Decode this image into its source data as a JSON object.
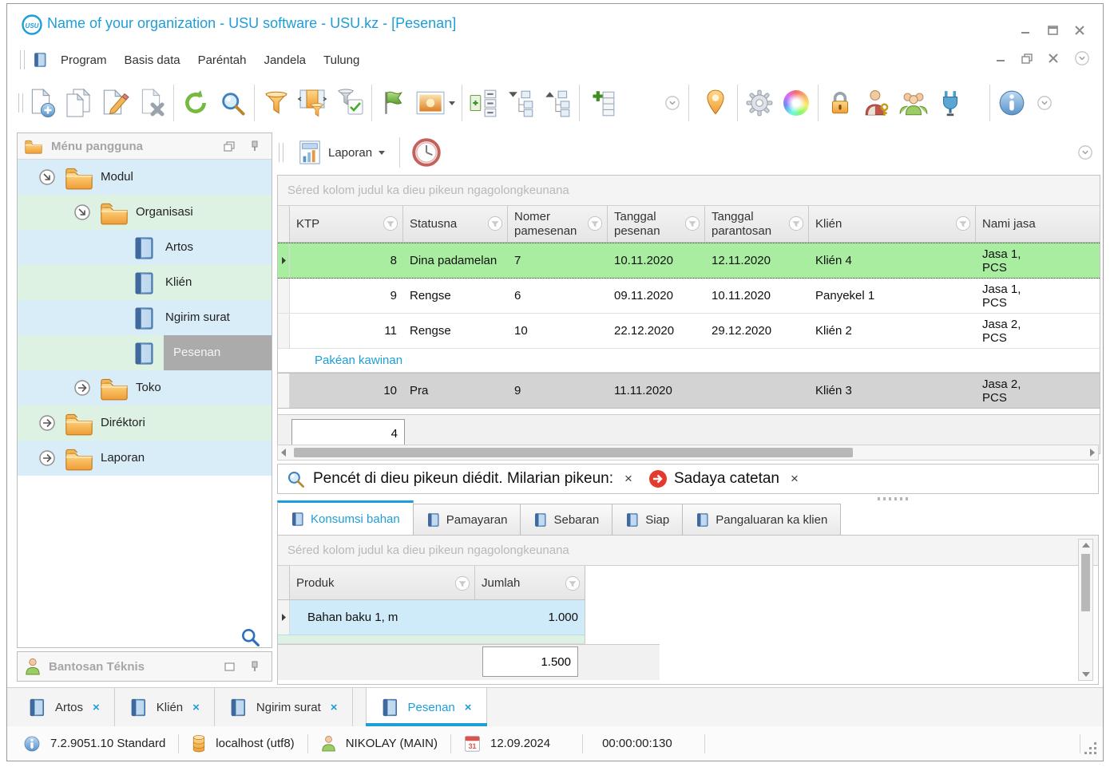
{
  "window": {
    "title": "Name of your organization - USU software - USU.kz - [Pesenan]",
    "logo_text": "USU"
  },
  "menu_bar": {
    "items": [
      "Program",
      "Basis data",
      "Paréntah",
      "Jandela",
      "Tulung"
    ]
  },
  "toolbar_icons": [
    "new-record",
    "copy-record",
    "edit-record",
    "delete-record",
    "refresh",
    "search",
    "filter",
    "filter-panel",
    "filter-apply",
    "flag",
    "image",
    "expand-rows",
    "collapse-tree",
    "expand-tree",
    "add-column",
    "overflow-chevron",
    "map-pin",
    "settings-gear",
    "color-wheel",
    "lock",
    "user-key",
    "users-group",
    "plug",
    "info"
  ],
  "sidebar": {
    "header": "Ménu pangguna",
    "tree": [
      {
        "label": "Modul"
      },
      {
        "label": "Organisasi"
      },
      {
        "label": "Artos"
      },
      {
        "label": "Klién"
      },
      {
        "label": "Ngirim surat"
      },
      {
        "label": "Pesenan"
      },
      {
        "label": "Toko"
      },
      {
        "label": "Diréktori"
      },
      {
        "label": "Laporan"
      }
    ],
    "support_header": "Bantosan Téknis"
  },
  "content_toolbar": {
    "laporan_button": "Laporan"
  },
  "main_grid": {
    "group_hint": "Séred kolom judul ka dieu pikeun ngagolongkeunana",
    "columns": [
      "KTP",
      "Statusna",
      "Nomer pamesenan",
      "Tanggal pesenan",
      "Tanggal parantosan",
      "Klién",
      "Nami jasa"
    ],
    "rows": [
      {
        "ktp": "8",
        "status": "Dina padamelan",
        "nomer": "7",
        "pesenan": "10.11.2020",
        "parantosan": "12.11.2020",
        "klien": "Klién 4",
        "jasa": "Jasa 1, PCS"
      },
      {
        "ktp": "9",
        "status": "Rengse",
        "nomer": "6",
        "pesenan": "09.11.2020",
        "parantosan": "10.11.2020",
        "klien": "Panyekel 1",
        "jasa": "Jasa 1, PCS"
      },
      {
        "ktp": "11",
        "status": "Rengse",
        "nomer": "10",
        "pesenan": "22.12.2020",
        "parantosan": "29.12.2020",
        "klien": "Klién 2",
        "jasa": "Jasa 2, PCS"
      },
      {
        "ktp": "10",
        "status": "Pra",
        "nomer": "9",
        "pesenan": "11.11.2020",
        "parantosan": "",
        "klien": "Klién 3",
        "jasa": "Jasa 2, PCS"
      }
    ],
    "link_row": "Pakéan kawinan",
    "count": "4"
  },
  "filter_bar": {
    "edit_hint": "Pencét di dieu pikeun diédit. Milarian pikeun:",
    "clear_x": "×",
    "scope": "Sadaya catetan",
    "scope_x": "×"
  },
  "detail_tabs": {
    "tabs": [
      {
        "label": "Konsumsi bahan"
      },
      {
        "label": "Pamayaran"
      },
      {
        "label": "Sebaran"
      },
      {
        "label": "Siap"
      },
      {
        "label": "Pangaluaran ka klien"
      }
    ]
  },
  "detail_grid": {
    "group_hint": "Séred kolom judul ka dieu pikeun ngagolongkeunana",
    "columns": [
      "Produk",
      "Jumlah"
    ],
    "rows": [
      {
        "produk": "Bahan baku 1, m",
        "jumlah": "1.000"
      }
    ],
    "total": "1.500"
  },
  "document_tabs": {
    "tabs": [
      {
        "label": "Artos",
        "close": "×"
      },
      {
        "label": "Klién",
        "close": "×"
      },
      {
        "label": "Ngirim surat",
        "close": "×"
      },
      {
        "label": "Pesenan",
        "close": "×"
      }
    ]
  },
  "status_bar": {
    "version": "7.2.9051.10 Standard",
    "database": "localhost (utf8)",
    "user": "NIKOLAY (MAIN)",
    "calendar_day": "31",
    "date": "12.09.2024",
    "time": "00:00:00:130"
  },
  "colors": {
    "accent": "#1e9ed8",
    "selected_row": "#a9eda1",
    "tree_blue": "#d9edf9",
    "tree_green": "#def2e3"
  }
}
